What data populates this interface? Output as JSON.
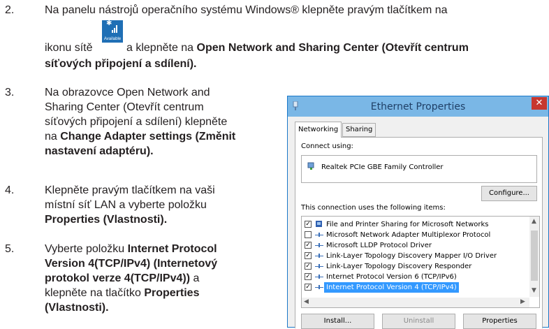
{
  "steps": {
    "s2": {
      "num": "2.",
      "line1": "Na panelu nástrojů operačního systému Windows® klepněte pravým tlačítkem na",
      "line2_pre": "ikonu sítě",
      "line2_mid": "a klepněte na",
      "line2_bold": "Open Network and Sharing Center (Otevřít centrum",
      "line3_bold": "síťových připojení a sdílení)."
    },
    "s3": {
      "num": "3.",
      "l1": "Na obrazovce Open Network and",
      "l2": "Sharing Center (Otevřít centrum",
      "l3": "síťových připojení a sdílení) klepněte",
      "l4_pre": "na",
      "l4_bold": "Change Adapter settings (Změnit",
      "l5_bold": "nastavení adaptéru)."
    },
    "s4": {
      "num": "4.",
      "l1": "Klepněte pravým tlačítkem na vaši",
      "l2": "místní síť LAN a vyberte položku",
      "l3_bold": "Properties (Vlastnosti)."
    },
    "s5": {
      "num": "5.",
      "l1_pre": "Vyberte položku",
      "l1_bold": "Internet Protocol",
      "l2_bold": "Version 4(TCP/IPv4) (Internetový",
      "l3_bold": "protokol verze 4(TCP/IPv4))",
      "l3_post": "a",
      "l4_pre": "klepněte na tlačítko",
      "l4_bold": "Properties",
      "l5_bold": "(Vlastnosti)."
    }
  },
  "network_icon": {
    "label": "Available",
    "icon": "wifi-signal-icon",
    "color": "#1f6fb5"
  },
  "dialog": {
    "title": "Ethernet Properties",
    "close": "✕",
    "tabs": [
      "Networking",
      "Sharing"
    ],
    "connect_using_label": "Connect using:",
    "adapter": "Realtek PCIe GBE Family Controller",
    "configure_button": "Configure...",
    "items_label": "This connection uses the following items:",
    "items": [
      {
        "label": "File and Printer Sharing for Microsoft Networks",
        "checked": true,
        "selected": false
      },
      {
        "label": "Microsoft Network Adapter Multiplexor Protocol",
        "checked": false,
        "selected": false
      },
      {
        "label": "Microsoft LLDP Protocol Driver",
        "checked": true,
        "selected": false
      },
      {
        "label": "Link-Layer Topology Discovery Mapper I/O Driver",
        "checked": true,
        "selected": false
      },
      {
        "label": "Link-Layer Topology Discovery Responder",
        "checked": true,
        "selected": false
      },
      {
        "label": "Internet Protocol Version 6 (TCP/IPv6)",
        "checked": true,
        "selected": false
      },
      {
        "label": "Internet Protocol Version 4 (TCP/IPv4)",
        "checked": true,
        "selected": true
      }
    ],
    "buttons": [
      "Install...",
      "Uninstall",
      "Properties"
    ],
    "accent": "#7ab7e6",
    "selection_color": "#3399ff"
  }
}
